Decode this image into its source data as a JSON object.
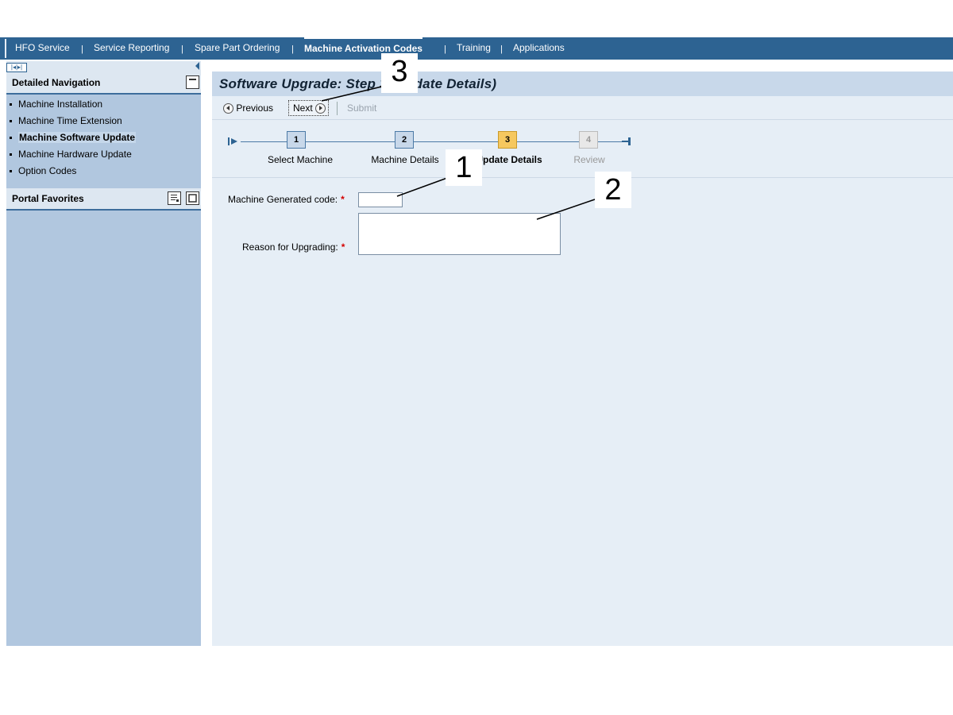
{
  "topnav": {
    "items": [
      {
        "label": "HFO Service",
        "active": false
      },
      {
        "label": "Service Reporting",
        "active": false
      },
      {
        "label": "Spare Part Ordering",
        "active": false
      },
      {
        "label": "Machine Activation Codes",
        "active": true
      },
      {
        "label": "Training",
        "active": false
      },
      {
        "label": "Applications",
        "active": false
      }
    ],
    "separator": "|"
  },
  "left_pane": {
    "toolbar_glyph": "|◂|▸|",
    "detailed_navigation": {
      "title": "Detailed Navigation",
      "items": [
        {
          "label": "Machine Installation",
          "selected": false
        },
        {
          "label": "Machine Time Extension",
          "selected": false
        },
        {
          "label": "Machine Software Update",
          "selected": true
        },
        {
          "label": "Machine Hardware Update",
          "selected": false
        },
        {
          "label": "Option Codes",
          "selected": false
        }
      ]
    },
    "portal_favorites": {
      "title": "Portal Favorites"
    }
  },
  "content": {
    "title": "Software Upgrade: Step 3 (Update Details)",
    "toolbar": {
      "previous": "Previous",
      "next": "Next",
      "submit": "Submit"
    },
    "roadmap": {
      "steps": [
        {
          "number": "1",
          "label": "Select Machine",
          "state": "done"
        },
        {
          "number": "2",
          "label": "Machine Details",
          "state": "done"
        },
        {
          "number": "3",
          "label": "Update Details",
          "state": "current"
        },
        {
          "number": "4",
          "label": "Review",
          "state": "future"
        }
      ]
    },
    "form": {
      "machine_code_label": "Machine Generated code:",
      "machine_code_value": "",
      "reason_label": "Reason for Upgrading:",
      "reason_value": "",
      "required_marker": "*"
    }
  },
  "callouts": {
    "one": "1",
    "two": "2",
    "three": "3"
  },
  "colors": {
    "topnav_bg": "#2d6392",
    "left_pane_bg": "#b1c7df",
    "content_bg": "#e6eef6",
    "current_step": "#f6c85f",
    "required": "#d40000"
  }
}
